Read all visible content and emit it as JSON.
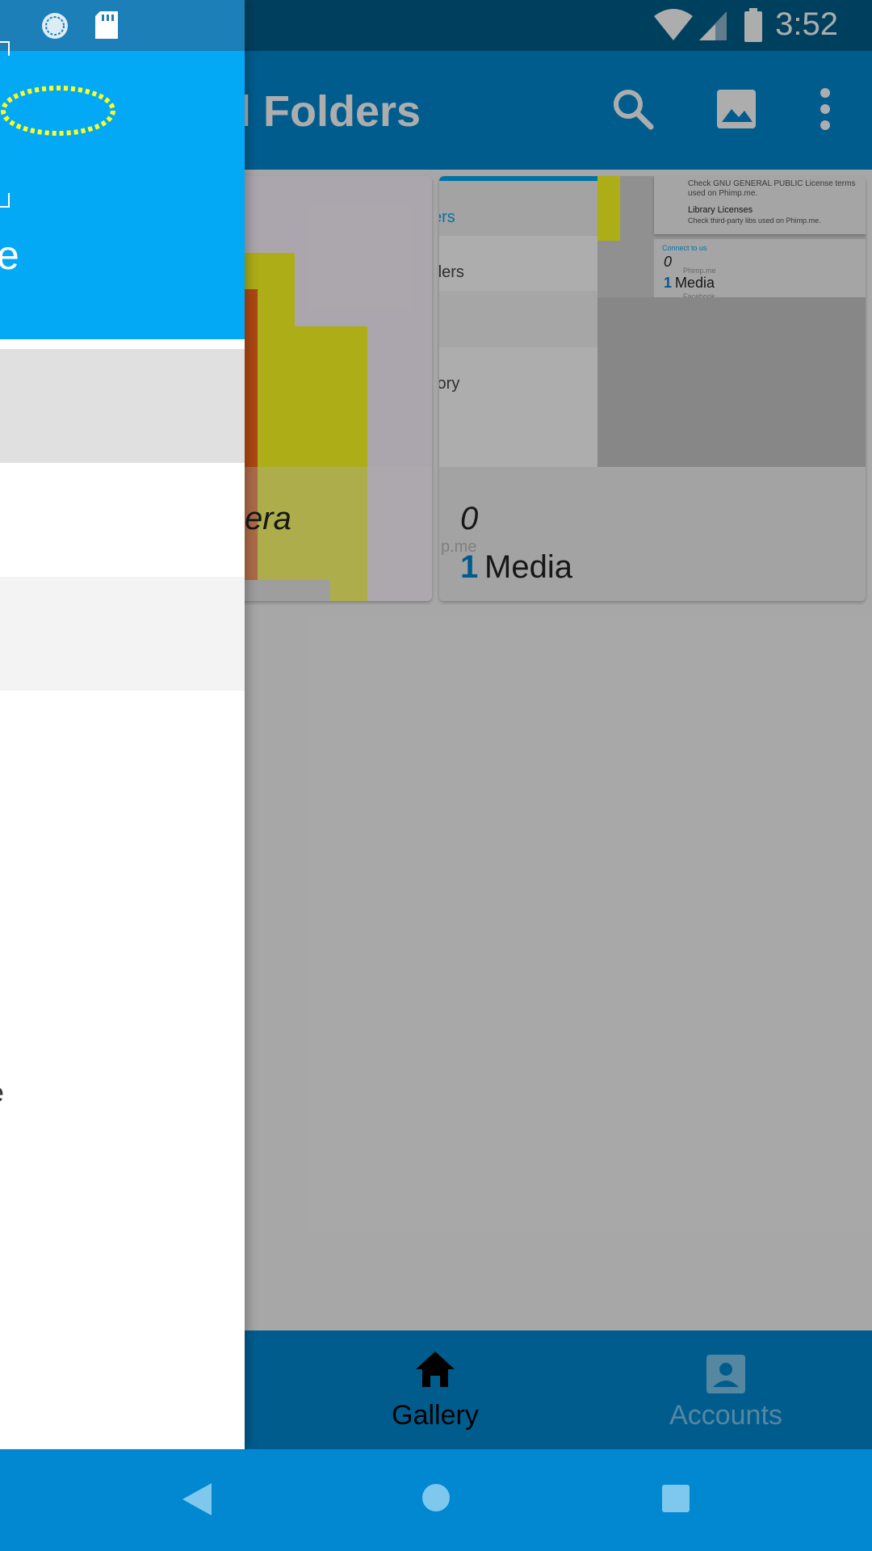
{
  "status_bar": {
    "time": "3:52",
    "icons": [
      "sync-icon",
      "sd-card-icon",
      "wifi-icon",
      "signal-icon",
      "battery-icon"
    ]
  },
  "toolbar": {
    "title": "l Folders",
    "icons": [
      "search-icon",
      "image-icon",
      "more-vert-icon"
    ]
  },
  "albums": [
    {
      "label": "era"
    },
    {
      "label": "0",
      "sublabel": "p.me",
      "media_count": "1",
      "media_word": "Media",
      "thumb_texts": [
        "ers",
        "ders",
        "tory"
      ]
    },
    {
      "thumb_title_1": "Library Licenses",
      "thumb_desc_1": "Check GNU GENERAL PUBLIC License terms used on Phimp.me.",
      "thumb_desc_2": "Check third-party libs used on Phimp.me.",
      "thumb_count": "0",
      "thumb_media_count": "1",
      "thumb_media_word": "Media",
      "thumb_link_1": "Phimp.me",
      "thumb_link_2": "Facebook",
      "thumb_section": "Connect to us"
    }
  ],
  "bottom_nav": {
    "items": [
      {
        "label": "Gallery",
        "icon": "home-icon",
        "active": true
      },
      {
        "label": "Accounts",
        "icon": "account-box-icon",
        "active": false
      }
    ]
  },
  "drawer": {
    "header_text": "e",
    "header_color": "#03a9f4",
    "logo": "dotted-oval-logo",
    "partial_item_text": "e"
  },
  "sys_nav": {
    "icons": [
      "back-icon",
      "home-circle-icon",
      "recents-icon"
    ]
  },
  "colors": {
    "primary": "#0288d1",
    "primary_dark": "#015f8c",
    "accent": "#03a9f4"
  }
}
